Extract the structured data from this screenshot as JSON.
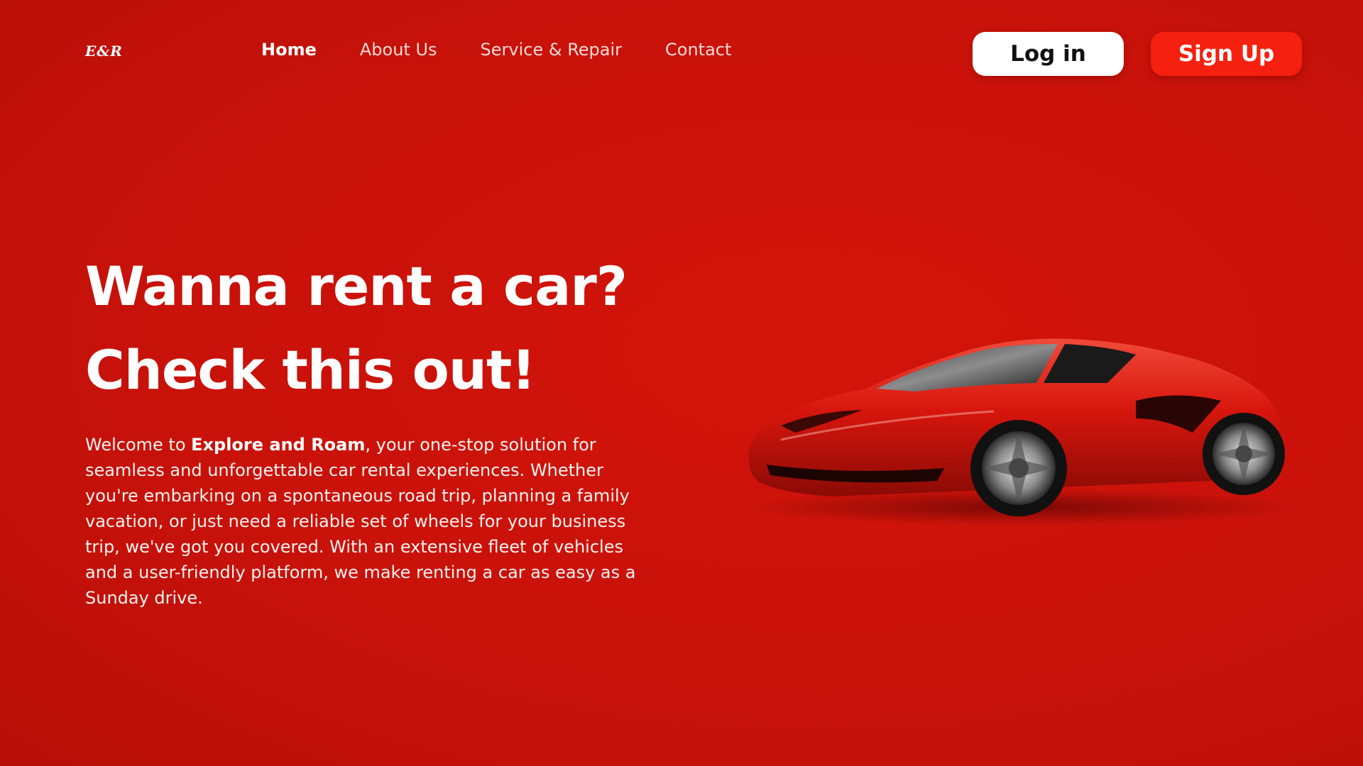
{
  "brand": {
    "logo_text": "E&R"
  },
  "nav": {
    "items": [
      {
        "label": "Home",
        "active": true
      },
      {
        "label": "About Us",
        "active": false
      },
      {
        "label": "Service & Repair",
        "active": false
      },
      {
        "label": "Contact",
        "active": false
      }
    ]
  },
  "auth": {
    "login_label": "Log in",
    "signup_label": "Sign Up"
  },
  "hero": {
    "title_line1": "Wanna rent a car?",
    "title_line2": "Check this out!",
    "desc_prefix": "Welcome to ",
    "desc_brand": "Explore and Roam",
    "desc_rest": ", your one-stop solution for seamless and unforgettable car rental experiences. Whether you're embarking on a spontaneous road trip, planning a family vacation, or just need a reliable set of wheels for your business trip, we've got you covered. With an extensive fleet of vehicles and a user-friendly platform, we make renting a car as easy as a Sunday drive."
  },
  "colors": {
    "background": "#c8120a",
    "accent": "#f5200f",
    "login_bg": "#ffffff",
    "car_body": "#d8160d"
  },
  "icons": {
    "hero_image": "red-sports-car-icon"
  }
}
